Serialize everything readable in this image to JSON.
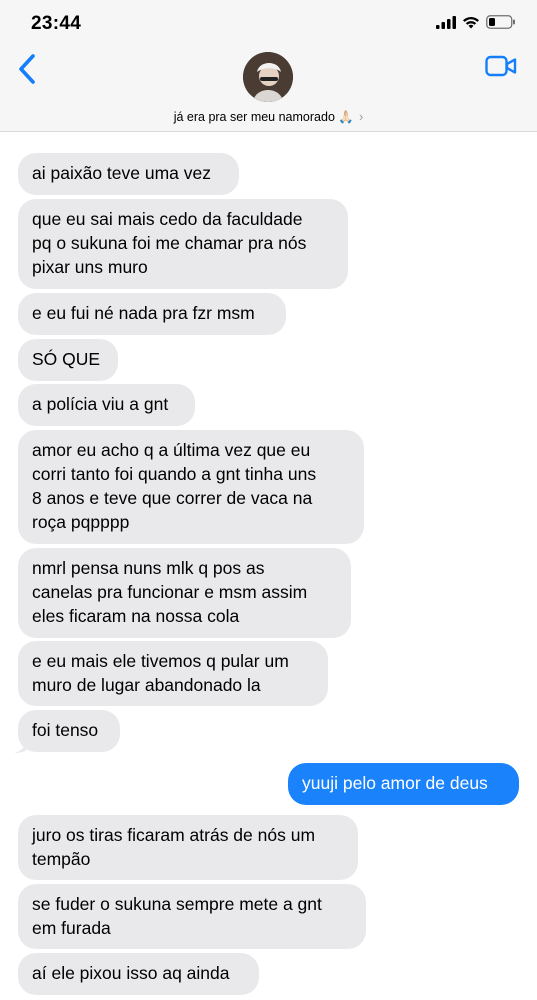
{
  "status_bar": {
    "time": "23:44",
    "icons": [
      "cellular-signal-icon",
      "wifi-icon",
      "battery-low-icon"
    ]
  },
  "header": {
    "back_icon": "chevron-left-icon",
    "contact_name": "já era pra ser meu namorado 🙏🏻",
    "video_icon": "video-camera-icon"
  },
  "colors": {
    "incoming_bubble": "#e9e9eb",
    "outgoing_bubble": "#1a82fb",
    "accent": "#147efb"
  },
  "messages": [
    {
      "direction": "incoming",
      "text": "ai paixão teve uma vez"
    },
    {
      "direction": "incoming",
      "text": "que eu sai mais cedo da faculdade\npq o sukuna foi me chamar pra nós\npixar uns muro"
    },
    {
      "direction": "incoming",
      "text": "e eu fui né nada pra fzr msm"
    },
    {
      "direction": "incoming",
      "text": "SÓ QUE"
    },
    {
      "direction": "incoming",
      "text": "a polícia viu a gnt"
    },
    {
      "direction": "incoming",
      "text": "amor eu acho q a última vez que eu\ncorri tanto foi quando a gnt tinha uns\n8 anos e teve que correr de vaca na\nroça pqpppp"
    },
    {
      "direction": "incoming",
      "text": "nmrl pensa nuns mlk q pos as\ncanelas pra funcionar e msm assim\neles ficaram na nossa cola"
    },
    {
      "direction": "incoming",
      "text": "e eu mais ele tivemos q pular um\nmuro de lugar abandonado la"
    },
    {
      "direction": "incoming",
      "text": "foi tenso"
    },
    {
      "direction": "outgoing",
      "text": "yuuji pelo amor de deus"
    },
    {
      "direction": "incoming",
      "text": "juro os tiras ficaram atrás de nós um\ntempão"
    },
    {
      "direction": "incoming",
      "text": "se fuder o sukuna sempre mete a gnt\nem furada"
    },
    {
      "direction": "incoming",
      "text": "aí ele pixou isso aq ainda"
    }
  ]
}
